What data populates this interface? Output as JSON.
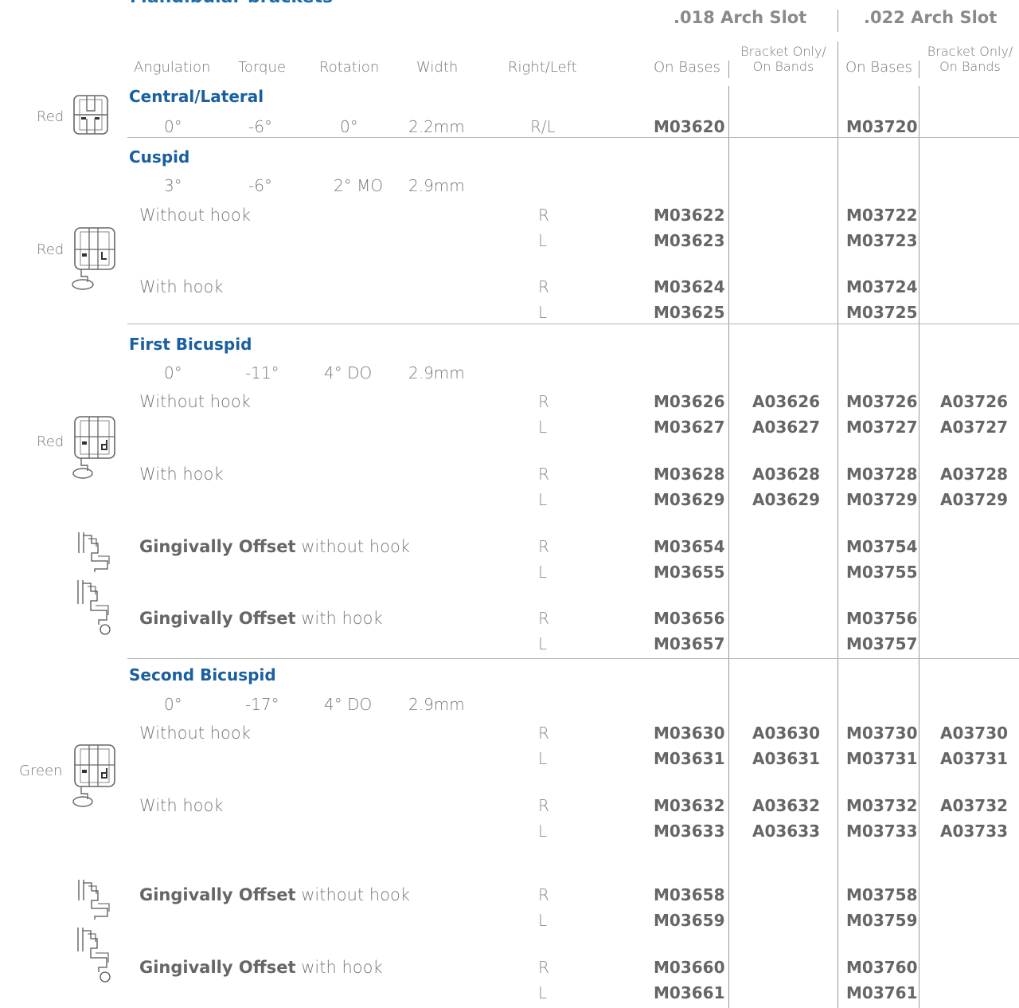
{
  "page": {
    "title": "Mandibular brackets",
    "slot018": ".018 Arch Slot",
    "slot022": ".022 Arch Slot"
  },
  "headers": {
    "angulation": "Angulation",
    "torque": "Torque",
    "rotation": "Rotation",
    "width": "Width",
    "right_left": "Right/Left",
    "on_bases": "On Bases",
    "bracket_only": "Bracket Only/",
    "on_bands": "On Bands"
  },
  "sections": {
    "central": {
      "title": "Central/Lateral",
      "color": "Red",
      "angulation": "0°",
      "torque": "-6°",
      "rotation": "0°",
      "width": "2.2mm",
      "rl": "R/L",
      "m018": "M03620",
      "m022": "M03720"
    },
    "cuspid": {
      "title": "Cuspid",
      "color": "Red",
      "angulation": "3°",
      "torque": "-6°",
      "rotation": "2° MO",
      "width": "2.9mm",
      "without_hook": "Without hook",
      "with_hook": "With hook",
      "rows": [
        {
          "rl": "R",
          "m018": "M03622",
          "m022": "M03722"
        },
        {
          "rl": "L",
          "m018": "M03623",
          "m022": "M03723"
        },
        {
          "rl": "R",
          "m018": "M03624",
          "m022": "M03724"
        },
        {
          "rl": "L",
          "m018": "M03625",
          "m022": "M03725"
        }
      ]
    },
    "first": {
      "title": "First Bicuspid",
      "color": "Red",
      "angulation": "0°",
      "torque": "-11°",
      "rotation": "4° DO",
      "width": "2.9mm",
      "without_hook": "Without hook",
      "with_hook": "With hook",
      "go_bold": "Gingivally Offset",
      "go_without": "without hook",
      "go_with": "with hook",
      "rows": [
        {
          "rl": "R",
          "m018": "M03626",
          "a018": "A03626",
          "m022": "M03726",
          "a022": "A03726"
        },
        {
          "rl": "L",
          "m018": "M03627",
          "a018": "A03627",
          "m022": "M03727",
          "a022": "A03727"
        },
        {
          "rl": "R",
          "m018": "M03628",
          "a018": "A03628",
          "m022": "M03728",
          "a022": "A03728"
        },
        {
          "rl": "L",
          "m018": "M03629",
          "a018": "A03629",
          "m022": "M03729",
          "a022": "A03729"
        },
        {
          "rl": "R",
          "m018": "M03654",
          "m022": "M03754"
        },
        {
          "rl": "L",
          "m018": "M03655",
          "m022": "M03755"
        },
        {
          "rl": "R",
          "m018": "M03656",
          "m022": "M03756"
        },
        {
          "rl": "L",
          "m018": "M03657",
          "m022": "M03757"
        }
      ]
    },
    "second": {
      "title": "Second Bicuspid",
      "color": "Green",
      "angulation": "0°",
      "torque": "-17°",
      "rotation": "4° DO",
      "width": "2.9mm",
      "without_hook": "Without hook",
      "with_hook": "With hook",
      "go_bold": "Gingivally Offset",
      "go_without": "without hook",
      "go_with": "with hook",
      "rows": [
        {
          "rl": "R",
          "m018": "M03630",
          "a018": "A03630",
          "m022": "M03730",
          "a022": "A03730"
        },
        {
          "rl": "L",
          "m018": "M03631",
          "a018": "A03631",
          "m022": "M03731",
          "a022": "A03731"
        },
        {
          "rl": "R",
          "m018": "M03632",
          "a018": "A03632",
          "m022": "M03732",
          "a022": "A03732"
        },
        {
          "rl": "L",
          "m018": "M03633",
          "a018": "A03633",
          "m022": "M03733",
          "a022": "A03733"
        },
        {
          "rl": "R",
          "m018": "M03658",
          "m022": "M03758"
        },
        {
          "rl": "L",
          "m018": "M03659",
          "m022": "M03759"
        },
        {
          "rl": "R",
          "m018": "M03660",
          "m022": "M03760"
        },
        {
          "rl": "L",
          "m018": "M03661",
          "m022": "M03761"
        }
      ]
    }
  },
  "icons": {
    "bracket": "bracket-icon",
    "bracket_hook": "bracket-with-hook-icon",
    "offset": "gingival-offset-icon",
    "offset_hook": "gingival-offset-hook-icon"
  }
}
